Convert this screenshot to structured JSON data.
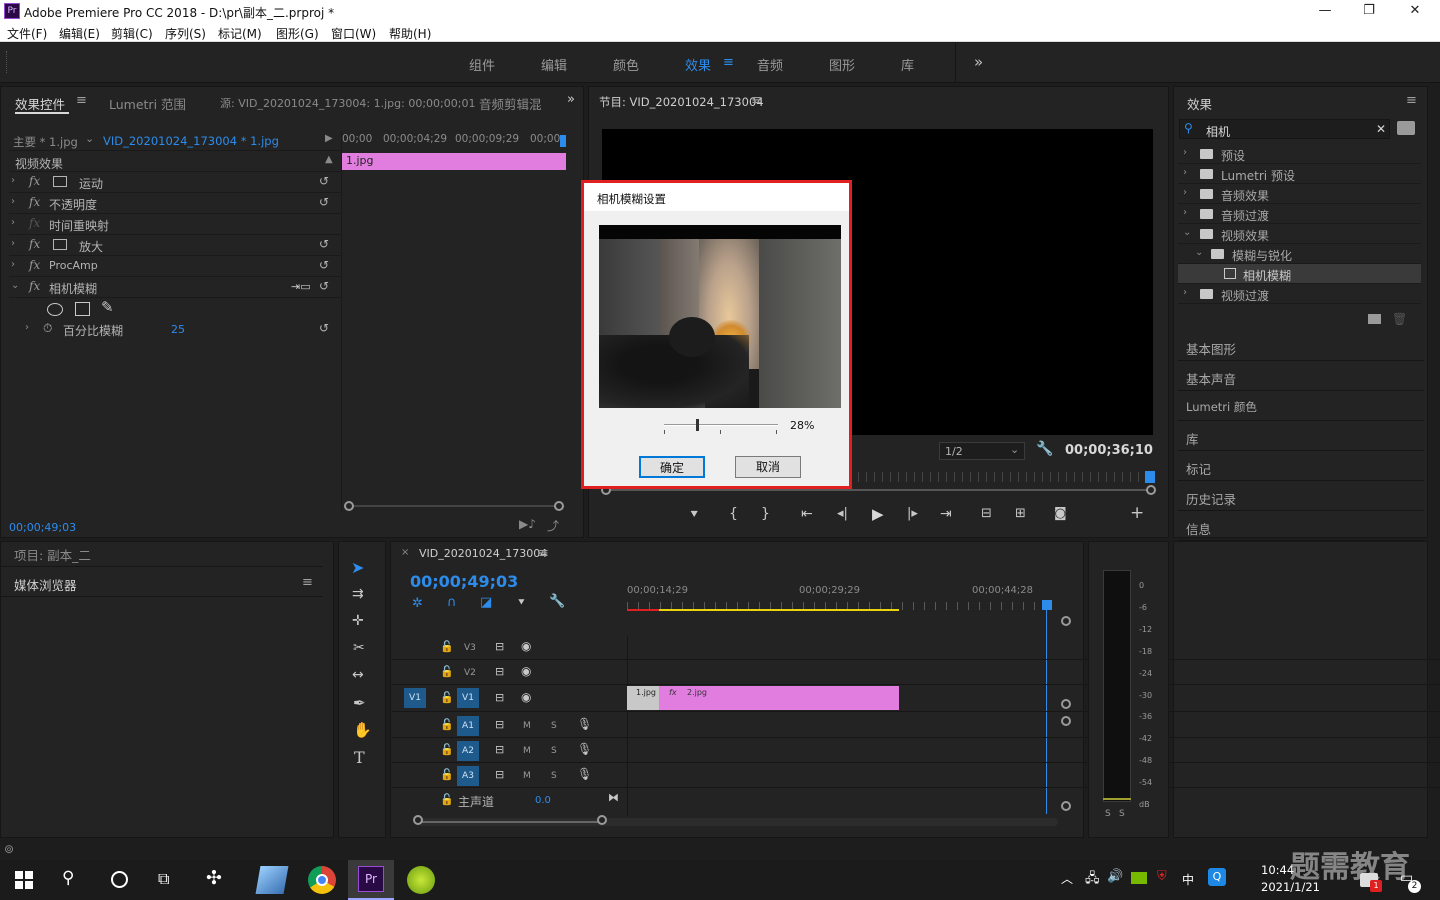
{
  "window": {
    "title": "Adobe Premiere Pro CC 2018 - D:\\pr\\副本_二.prproj *",
    "logo": "Pr",
    "minimize": "—",
    "maximize": "❐",
    "close": "✕"
  },
  "menu": [
    "文件(F)",
    "编辑(E)",
    "剪辑(C)",
    "序列(S)",
    "标记(M)",
    "图形(G)",
    "窗口(W)",
    "帮助(H)"
  ],
  "workspaces": {
    "items": [
      "组件",
      "编辑",
      "颜色",
      "效果",
      "音频",
      "图形",
      "库"
    ],
    "active": "效果",
    "more": "»"
  },
  "effect_controls": {
    "tabs": [
      "效果控件",
      "Lumetri 范围",
      "源: VID_20201024_173004: 1.jpg: 00;00;00;01",
      "音频剪辑混"
    ],
    "master": "主要 * 1.jpg",
    "clip": "VID_20201024_173004 * 1.jpg",
    "ruler": [
      "00;00",
      "00;00;04;29",
      "00;00;09;29",
      "00;00"
    ],
    "clip_bar": "1.jpg",
    "section": "视频效果",
    "rows": [
      {
        "label": "运动",
        "fx": "fx"
      },
      {
        "label": "不透明度",
        "fx": "fx"
      },
      {
        "label": "时间重映射",
        "fx": "fx"
      },
      {
        "label": "放大",
        "fx": "fx"
      },
      {
        "label": "ProcAmp",
        "fx": "fx"
      },
      {
        "label": "相机模糊",
        "fx": "fx"
      }
    ],
    "param_label": "百分比模糊",
    "param_value": "25",
    "timecode": "00;00;49;03"
  },
  "program": {
    "title": "节目: VID_20201024_173004",
    "scale": "1/2",
    "timecode": "00;00;36;10"
  },
  "effects_panel": {
    "title": "效果",
    "search_value": "相机",
    "items": [
      {
        "label": "预设",
        "level": 0
      },
      {
        "label": "Lumetri 预设",
        "level": 0
      },
      {
        "label": "音频效果",
        "level": 0
      },
      {
        "label": "音频过渡",
        "level": 0
      },
      {
        "label": "视频效果",
        "level": 0
      },
      {
        "label": "模糊与锐化",
        "level": 1
      },
      {
        "label": "相机模糊",
        "level": 2
      },
      {
        "label": "视频过渡",
        "level": 0
      }
    ],
    "panels": [
      "基本图形",
      "基本声音",
      "Lumetri 颜色",
      "库",
      "标记",
      "历史记录",
      "信息"
    ]
  },
  "project": {
    "title": "项目: 副本_二",
    "media_browser": "媒体浏览器"
  },
  "timeline": {
    "title": "VID_20201024_173004",
    "timecode": "00;00;49;03",
    "ruler": [
      "00;00;14;29",
      "00;00;29;29",
      "00;00;44;28"
    ],
    "tracks": {
      "video": [
        "V3",
        "V2",
        "V1"
      ],
      "audio": [
        "A1",
        "A2",
        "A3"
      ],
      "source_v": "V1",
      "master": "主声道",
      "master_value": "0.0",
      "mute": "M",
      "solo": "S"
    },
    "clips": [
      {
        "label": "1.jpg"
      },
      {
        "label": "2.jpg",
        "fx": "fx"
      }
    ]
  },
  "meter": {
    "scale": [
      "0",
      "-6",
      "-12",
      "-18",
      "-24",
      "-30",
      "-36",
      "-42",
      "-48",
      "-54",
      "dB"
    ],
    "solo": [
      "S",
      "S"
    ]
  },
  "dialog": {
    "title": "相机模糊设置",
    "percent": "28%",
    "ok": "确定",
    "cancel": "取消"
  },
  "taskbar": {
    "time": "10:44",
    "date": "2021/1/21",
    "ime": "中",
    "watermark": "题需教育",
    "badge_count": "2",
    "mail_badge": "1"
  },
  "colors": {
    "accent": "#2d8ceb",
    "clip_pink": "#e27de0",
    "dialog_highlight": "#e02020",
    "timeline_yellow": "#e8d40c"
  }
}
